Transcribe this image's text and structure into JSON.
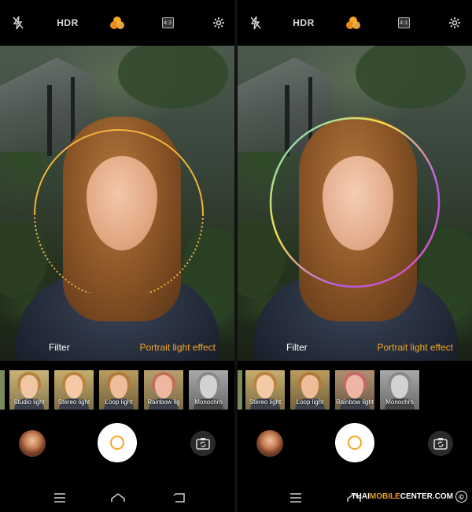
{
  "top_bar": {
    "hdr_label": "HDR",
    "ratio_label": "4:3",
    "icons": [
      "flash-off-icon",
      "filters-icon",
      "settings-icon"
    ],
    "accent": "#f5a623"
  },
  "panels": [
    {
      "labels": {
        "filter": "Filter",
        "portrait_light_effect": "Portrait light effect"
      },
      "ring_style": "dotted-gold",
      "thumbnails": [
        {
          "label": "",
          "partial": true
        },
        {
          "label": "Studio light"
        },
        {
          "label": "Stereo light"
        },
        {
          "label": "Loop light",
          "selected": true
        },
        {
          "label": "Rainbow lig"
        },
        {
          "label": "Monochro"
        }
      ]
    },
    {
      "labels": {
        "filter": "Filter",
        "portrait_light_effect": "Portrait light effect"
      },
      "ring_style": "rainbow",
      "thumbnails": [
        {
          "label": "",
          "partial": true
        },
        {
          "label": "Stereo light"
        },
        {
          "label": "Loop light"
        },
        {
          "label": "Rainbow light",
          "selected": true
        },
        {
          "label": "Monochro"
        }
      ]
    }
  ],
  "watermark": {
    "prefix": "THAI",
    "middle": "MOBILE",
    "suffix": "CENTER.COM",
    "symbol": "©"
  },
  "colors": {
    "selected_border": "#f39a22",
    "filter_label": "#ffffff",
    "portrait_label": "#f5a623"
  }
}
